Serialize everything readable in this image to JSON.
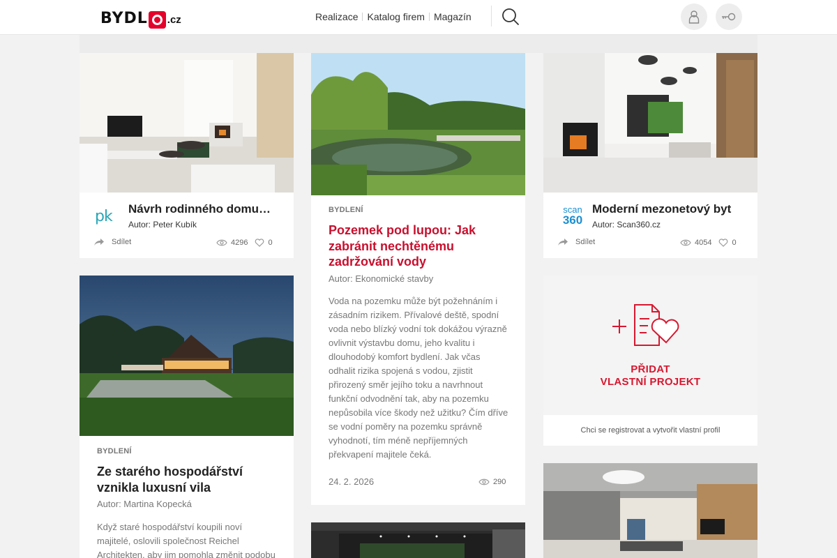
{
  "header": {
    "logo_text": "BYDL",
    "logo_suffix": ".cz",
    "nav": [
      "Realizace",
      "Katalog firem",
      "Magazín"
    ]
  },
  "cards": {
    "project1": {
      "title": "Návrh rodinného domu…",
      "author": "Autor: Peter Kubík",
      "share_label": "Sdílet",
      "views": "4296",
      "likes": "0",
      "logo_text": "pk"
    },
    "article1": {
      "category": "BYDLENÍ",
      "title": "Pozemek pod lupou: Jak zabránit nechtěnému zadržování vody",
      "author": "Autor: Ekonomické stavby",
      "text": "Voda na pozemku může být požehnáním i zásadním rizikem. Přívalové deště, spodní voda nebo blízký vodní tok dokážou výrazně ovlivnit výstavbu domu, jeho kvalitu i dlouhodobý komfort bydlení. Jak včas odhalit rizika spojená s vodou, zjistit přirozený směr jejího toku a navrhnout funkční odvodnění tak, aby na pozemku nepůsobila více škody než užitku? Čím dříve se vodní poměry na pozemku správně vyhodnotí, tím méně nepříjemných překvapení majitele čeká.",
      "date": "24. 2. 2026",
      "views": "290"
    },
    "project2": {
      "title": "Moderní mezonetový byt",
      "author": "Autor: Scan360.cz",
      "share_label": "Sdílet",
      "views": "4054",
      "likes": "0",
      "logo_top": "scan",
      "logo_bottom": "360"
    },
    "article2": {
      "category": "BYDLENÍ",
      "title": "Ze starého hospodářství vznikla luxusní vila",
      "author": "Autor: Martina Kopecká",
      "text": "Když staré hospodářství koupili noví majitelé, oslovili společnost Reichel Architekten, aby jim pomohla změnit podobu"
    },
    "add_project": {
      "label_line1": "PŘIDAT",
      "label_line2": "VLASTNÍ PROJEKT",
      "subtext": "Chci se registrovat a vytvořit vlastní profil"
    }
  },
  "colors": {
    "accent_red": "#c8102e",
    "logo_red": "#e4002b",
    "page_bg": "#f2f2f2"
  }
}
